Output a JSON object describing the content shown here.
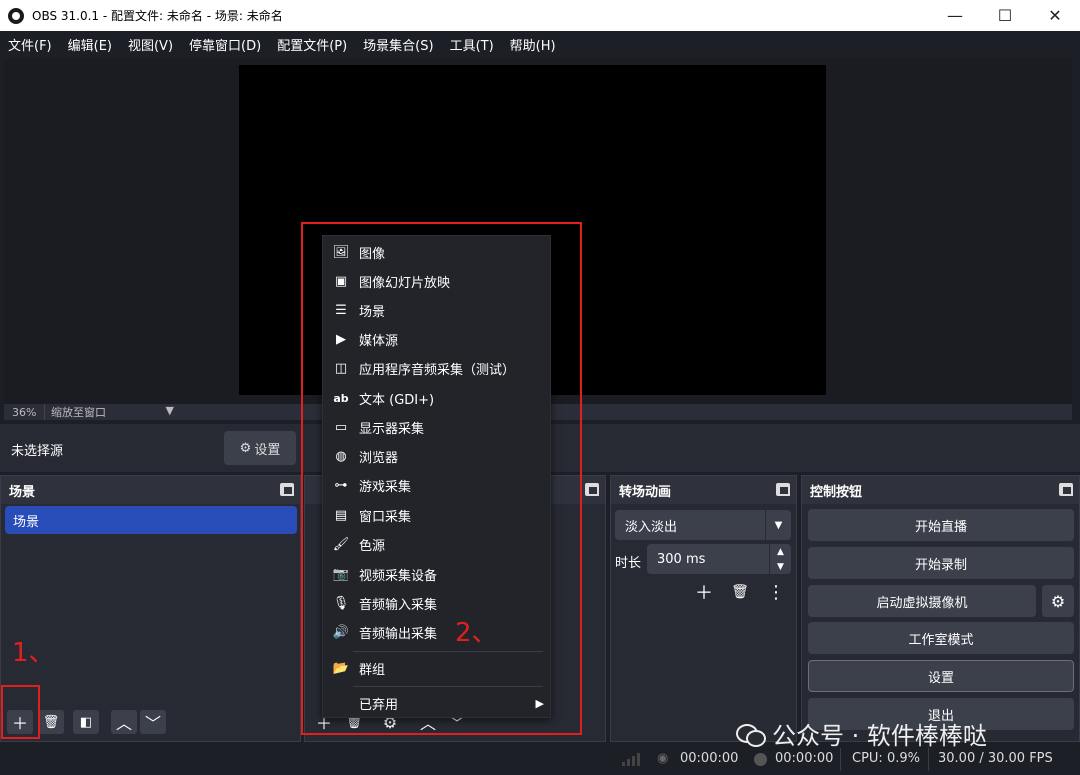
{
  "window": {
    "title": "OBS 31.0.1 - 配置文件: 未命名 - 场景: 未命名",
    "controls": [
      "—",
      "☐",
      "✕"
    ]
  },
  "menu": [
    "文件(F)",
    "编辑(E)",
    "视图(V)",
    "停靠窗口(D)",
    "配置文件(P)",
    "场景集合(S)",
    "工具(T)",
    "帮助(H)"
  ],
  "preview": {
    "zoom_pct": "36%",
    "zoom_mode": "缩放至窗口"
  },
  "source_bar": {
    "status": "未选择源",
    "settings_label": "设置"
  },
  "scenes_dock": {
    "title": "场景",
    "items": [
      "场景"
    ]
  },
  "transitions_dock": {
    "title": "转场动画",
    "selected": "淡入淡出",
    "duration_label": "时长",
    "duration_value": "300 ms"
  },
  "controls_dock": {
    "title": "控制按钮",
    "buttons": [
      "开始直播",
      "开始录制",
      "启动虚拟摄像机",
      "工作室模式",
      "设置",
      "退出"
    ]
  },
  "context_menu": {
    "items": [
      {
        "label": "图像",
        "icon": "image-icon"
      },
      {
        "label": "图像幻灯片放映",
        "icon": "slideshow-icon"
      },
      {
        "label": "场景",
        "icon": "list-icon"
      },
      {
        "label": "媒体源",
        "icon": "play-icon"
      },
      {
        "label": "应用程序音频采集（测试）",
        "icon": "app-audio-icon"
      },
      {
        "label": "文本 (GDI+)",
        "icon": "text-icon"
      },
      {
        "label": "显示器采集",
        "icon": "monitor-icon"
      },
      {
        "label": "浏览器",
        "icon": "globe-icon"
      },
      {
        "label": "游戏采集",
        "icon": "gamepad-icon"
      },
      {
        "label": "窗口采集",
        "icon": "window-icon"
      },
      {
        "label": "色源",
        "icon": "brush-icon"
      },
      {
        "label": "视频采集设备",
        "icon": "camera-icon"
      },
      {
        "label": "音频输入采集",
        "icon": "mic-icon"
      },
      {
        "label": "音频输出采集",
        "icon": "speaker-icon"
      },
      {
        "label": "群组",
        "icon": "folder-icon"
      },
      {
        "label": "已弃用",
        "icon": ""
      }
    ]
  },
  "status_bar": {
    "stream_time": "00:00:00",
    "rec_time": "00:00:00",
    "cpu": "CPU: 0.9%",
    "fps": "30.00 / 30.00 FPS"
  },
  "annotations": {
    "step1": "1、",
    "step2": "2、"
  },
  "watermark": "公众号 · 软件棒棒哒",
  "colors": {
    "background": "#1d1f26",
    "dock": "#272a33",
    "accent_selected": "#284cb8",
    "annotation": "#e02020"
  }
}
